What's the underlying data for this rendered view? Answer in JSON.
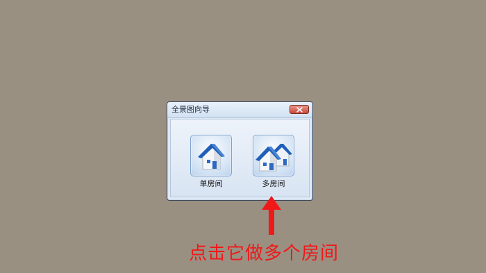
{
  "dialog": {
    "title": "全景图向导",
    "close_icon": "close-icon",
    "options": [
      {
        "label": "单房间",
        "icon": "single-house-icon"
      },
      {
        "label": "多房间",
        "icon": "multiple-houses-icon"
      }
    ]
  },
  "annotation": {
    "caption": "点击它做多个房间",
    "arrow_icon": "up-arrow-icon",
    "color": "#f01818"
  },
  "colors": {
    "background": "#9a9082",
    "house_roof": "#1f5fb8",
    "close_button": "#c9493a"
  }
}
